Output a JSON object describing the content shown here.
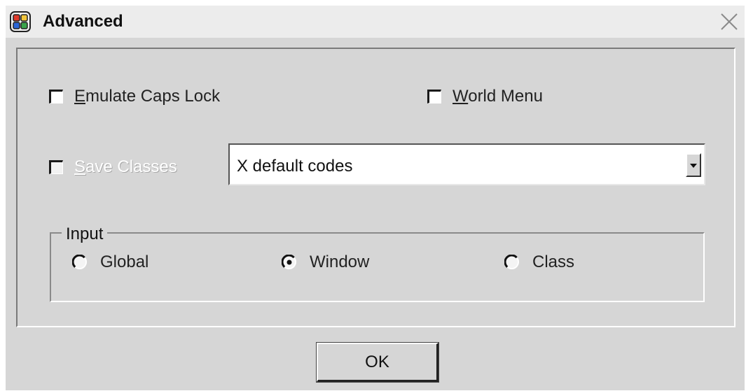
{
  "window": {
    "title": "Advanced",
    "icon": "app-palette-icon",
    "close_icon": "close-icon"
  },
  "options": {
    "emulate_caps_lock": {
      "label": "Emulate Caps Lock",
      "mnemonic": "E",
      "rest": "mulate Caps Lock",
      "checked": false
    },
    "world_menu": {
      "label": "World Menu",
      "mnemonic": "W",
      "rest": "orld Menu",
      "checked": false
    },
    "save_classes": {
      "label": "Save Classes",
      "mnemonic": "S",
      "rest": "ave Classes",
      "checked": false,
      "enabled": false
    }
  },
  "keycodes_select": {
    "value": "X default codes"
  },
  "input_group": {
    "legend": "Input",
    "options": [
      {
        "label": "Global",
        "selected": false
      },
      {
        "label": "Window",
        "selected": true
      },
      {
        "label": "Class",
        "selected": false
      }
    ]
  },
  "buttons": {
    "ok_label": "OK"
  },
  "colors": {
    "face": "#d6d6d6",
    "titlebar": "#ececec",
    "field": "#ffffff"
  }
}
